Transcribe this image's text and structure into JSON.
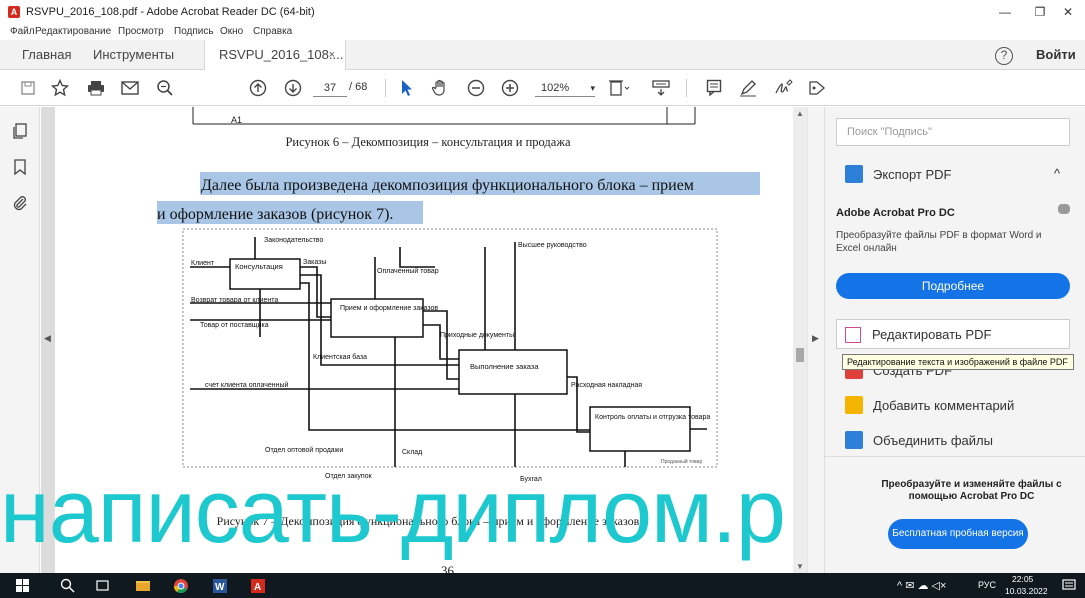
{
  "window": {
    "title": "RSVPU_2016_108.pdf - Adobe Acrobat Reader DC (64-bit)",
    "minimize_glyph": "—",
    "restore_glyph": "❐",
    "close_glyph": "✕"
  },
  "menu": [
    "Файл",
    "Редактирование",
    "Просмотр",
    "Подпись",
    "Окно",
    "Справка"
  ],
  "tabs": {
    "home": "Главная",
    "tools": "Инструменты",
    "document": "RSVPU_2016_108....",
    "close_glyph": "×"
  },
  "header_right": {
    "help": "?",
    "login": "Войти"
  },
  "toolbar": {
    "page_current": "37",
    "page_total": "/ 68",
    "zoom": "102%",
    "zoom_caret": "▾",
    "icons": [
      "save-icon",
      "bookmark-star-icon",
      "print-icon",
      "email-icon",
      "search-zoom-icon",
      "page-up-icon",
      "page-down-icon",
      "select-cursor-icon",
      "hand-icon",
      "zoom-out-icon",
      "zoom-in-icon",
      "fit-page-icon",
      "scroll-mode-icon",
      "comment-icon",
      "highlight-pen-icon",
      "sign-icon",
      "more-tools-icon"
    ]
  },
  "left_rail": {
    "icons": [
      "pages-icon",
      "bookmarks-icon",
      "attachments-icon"
    ]
  },
  "document": {
    "fig6_box_text": "A1",
    "caption6": "Рисунок 6 – Декомпозиция – консультация и продажа",
    "paragraph_line1": "Далее была произведена декомпозиция функционального блока – прием",
    "paragraph_line2": "и оформление заказов (рисунок 7).",
    "caption7": "Рисунок 7 – Декомпозиция функционального блока – прием и оформление заказов",
    "page_number": "36",
    "diagram": {
      "blocks": [
        "Консультация",
        "Прием и оформление заказов",
        "Выполнение заказа",
        "Контроль оплаты и отгрузка товара"
      ],
      "labels": {
        "legislation": "Законодательство",
        "management": "Высшее руководство",
        "client": "Клиент",
        "orders": "Заказы",
        "paid_goods": "Оплаченный товар",
        "return": "Возврат товара от клиента",
        "goods_supplier": "Товар от поставщика",
        "receipts": "Приходные документы",
        "client_base": "Клиентская база",
        "invoice_paid": "счет клиента оплаченный",
        "waybill": "Расходная накладная",
        "sales_dept": "Отдел оптовой продажи",
        "warehouse": "Склад",
        "order_dept": "Отдел закупок",
        "accounting": "Бухгал",
        "released": "Проданный товар"
      }
    },
    "watermark": "написать-диплом.р"
  },
  "right_pane": {
    "search_placeholder": "Поиск \"Подпись\"",
    "export": "Экспорт PDF",
    "collapse_glyph": "^",
    "promo_title": "Adobe Acrobat Pro DC",
    "promo_text": "Преобразуйте файлы PDF в формат Word и Excel онлайн",
    "promo_button": "Подробнее",
    "edit_pdf": "Редактировать PDF",
    "create_pdf": "Создать PDF",
    "add_comment": "Добавить комментарий",
    "combine": "Объединить файлы",
    "trial_text": "Преобразуйте и изменяйте файлы с помощью Acrobat Pro DC",
    "trial_button": "Бесплатная пробная версия"
  },
  "tooltip": "Редактирование текста и изображений в файле PDF",
  "taskbar": {
    "lang": "РУС",
    "time": "22:05",
    "date": "10.03.2022"
  }
}
